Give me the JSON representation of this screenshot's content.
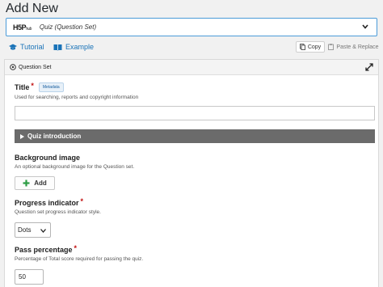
{
  "page_title": "Add New",
  "content_type": {
    "logo_text": "H5P",
    "logo_suffix": "hub",
    "name": "Quiz (Question Set)"
  },
  "links": {
    "tutorial": "Tutorial",
    "example": "Example"
  },
  "toolbar": {
    "copy": "Copy",
    "paste_replace": "Paste & Replace"
  },
  "editor": {
    "header": "Question Set",
    "title_field": {
      "label": "Title",
      "badge": "Metadata",
      "description": "Used for searching, reports and copyright information",
      "value": ""
    },
    "quiz_intro": "Quiz introduction",
    "background": {
      "label": "Background image",
      "description": "An optional background image for the Question set.",
      "add_label": "Add"
    },
    "progress": {
      "label": "Progress indicator",
      "description": "Question set progress indicator style.",
      "selected": "Dots"
    },
    "pass": {
      "label": "Pass percentage",
      "description": "Percentage of Total score required for passing the quiz.",
      "value": "50"
    }
  },
  "colors": {
    "link": "#1a73b8",
    "required": "#c10e0e",
    "group_bar": "#6b6b6b",
    "add_green": "#2e9d45",
    "select_border": "#4b9bd8"
  },
  "icons": [
    "chevron-down-icon",
    "tutorial-icon",
    "example-icon",
    "copy-icon",
    "paste-icon",
    "question-set-icon",
    "expand-icon",
    "triangle-right-icon",
    "plus-icon"
  ]
}
